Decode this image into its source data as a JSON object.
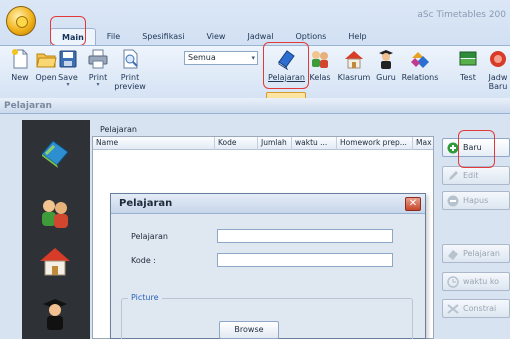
{
  "app": {
    "title": "aSc Timetables 200"
  },
  "ribbon": {
    "tabs": [
      {
        "label": "Main",
        "active": true
      },
      {
        "label": "File"
      },
      {
        "label": "Spesifikasi"
      },
      {
        "label": "View"
      },
      {
        "label": "Jadwal"
      },
      {
        "label": "Options"
      },
      {
        "label": "Help"
      }
    ],
    "buttons": [
      {
        "label": "New",
        "icon": "new-document-icon"
      },
      {
        "label": "Open",
        "icon": "open-folder-icon"
      },
      {
        "label": "Save",
        "icon": "save-icon"
      },
      {
        "label": "Print",
        "icon": "printer-icon"
      },
      {
        "label": "Print",
        "label2": "preview",
        "icon": "print-preview-icon"
      },
      {
        "label": "Pelajaran",
        "icon": "book-icon",
        "active": true
      },
      {
        "label": "Kelas",
        "icon": "students-icon"
      },
      {
        "label": "Klasrum",
        "icon": "classroom-house-icon"
      },
      {
        "label": "Guru",
        "icon": "teacher-icon"
      },
      {
        "label": "Relations",
        "icon": "relations-icon"
      },
      {
        "label": "Test",
        "icon": "test-icon"
      },
      {
        "label": "Jadw",
        "label2": "Baru",
        "icon": "new-timetable-icon"
      }
    ],
    "filter": {
      "value": "Semua"
    },
    "dropdown_glyph": "▾"
  },
  "window": {
    "title": "Pelajaran"
  },
  "list": {
    "label": "Pelajaran",
    "columns": [
      "Name",
      "Kode",
      "Jumlah",
      "waktu ...",
      "Homework prep...",
      "Max"
    ]
  },
  "side_buttons": [
    {
      "label": "Baru",
      "icon": "plus-circle-icon",
      "enabled": true
    },
    {
      "label": "Edit",
      "icon": "edit-icon",
      "enabled": false
    },
    {
      "label": "Hapus",
      "icon": "minus-circle-icon",
      "enabled": false
    },
    {
      "label": "Pelajaran",
      "icon": "book-icon",
      "enabled": false
    },
    {
      "label": "waktu ko",
      "icon": "clock-icon",
      "enabled": false
    },
    {
      "label": "Constrai",
      "icon": "constraints-icon",
      "enabled": false
    }
  ],
  "dialog": {
    "title": "Pelajaran",
    "close_glyph": "✕",
    "fields": [
      {
        "label": "Pelajaran",
        "value": ""
      },
      {
        "label": "Kode :",
        "value": ""
      }
    ],
    "picture_legend": "Picture",
    "browse_label": "Browse"
  },
  "colors": {
    "highlight": "#e23a3a",
    "accent": "#2a62b8"
  }
}
